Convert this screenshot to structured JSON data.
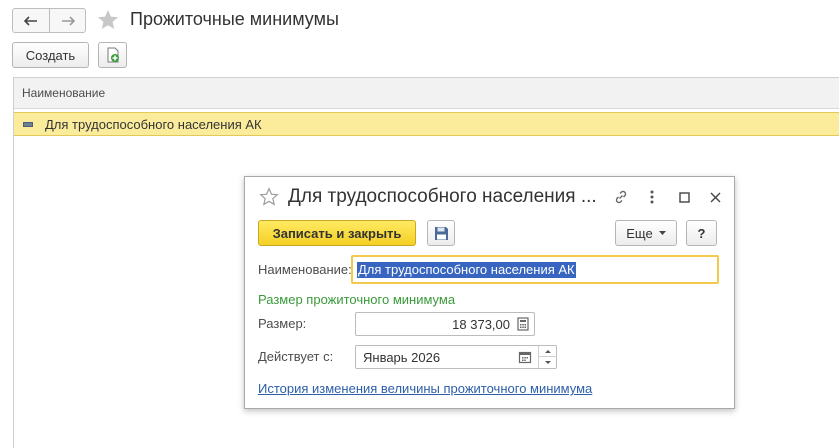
{
  "window": {
    "title": "Прожиточные минимумы",
    "back_icon": "arrow-left-icon",
    "forward_icon": "arrow-right-icon",
    "favorite_icon": "star-icon"
  },
  "toolbar": {
    "create_label": "Создать",
    "add_icon": "add-document-icon"
  },
  "list": {
    "columns": [
      "Наименование"
    ],
    "rows": [
      {
        "name": "Для трудоспособного населения АК",
        "selected": true
      }
    ]
  },
  "dialog": {
    "title": "Для трудоспособного населения ...",
    "save_close_label": "Записать и закрыть",
    "more_label": "Еще",
    "help_label": "?",
    "fields": {
      "name_label": "Наименование:",
      "name_value": "Для трудоспособного населения АК",
      "section_label": "Размер прожиточного минимума",
      "size_label": "Размер:",
      "size_value": "18 373,00",
      "date_label": "Действует с:",
      "date_value": "Январь 2026"
    },
    "history_link": "История изменения величины прожиточного минимума"
  },
  "colors": {
    "accent_yellow": "#f4d024",
    "selection_row": "#fbec9c",
    "section_green": "#3a9a3a",
    "link_blue": "#2d5eaa",
    "text_selection": "#3865c0"
  }
}
